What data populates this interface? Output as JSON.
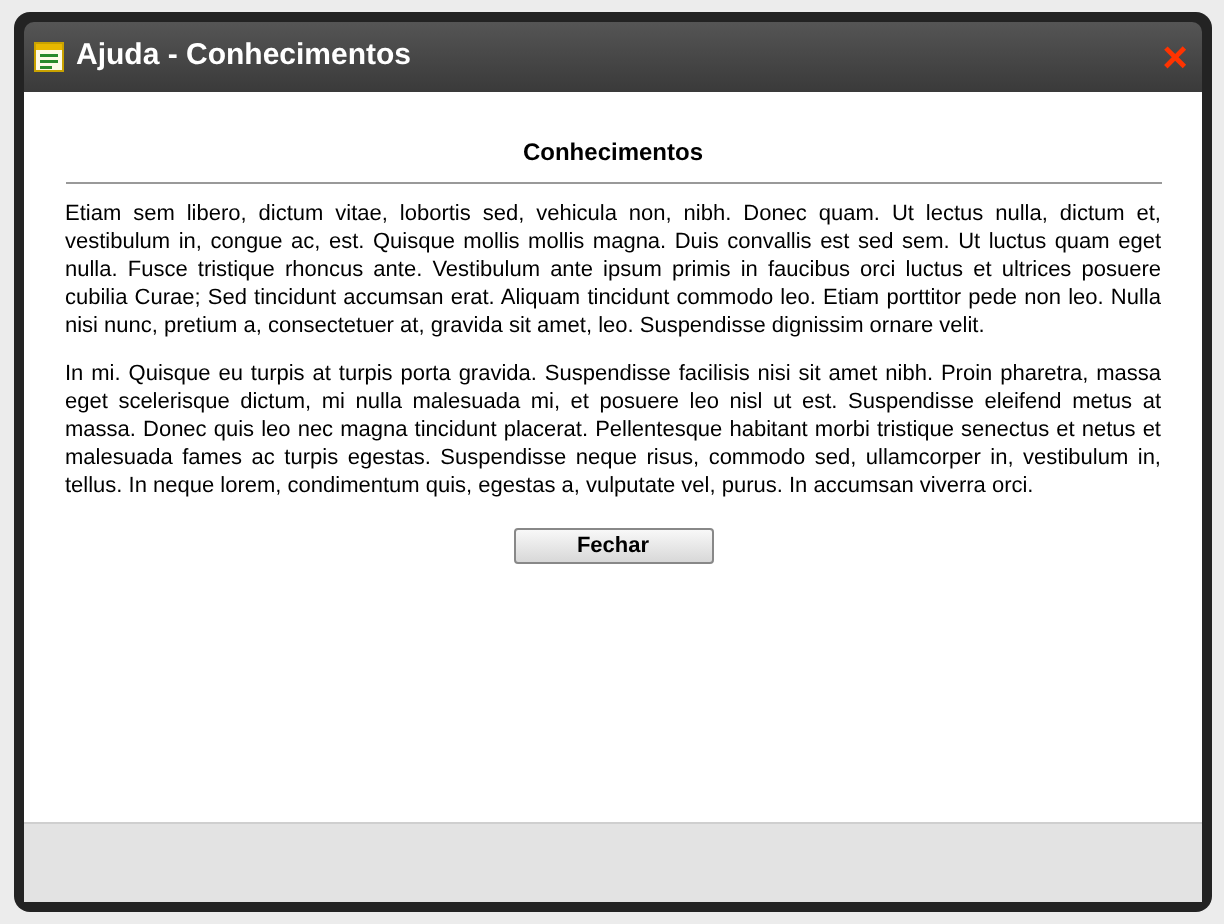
{
  "window": {
    "title": "Ajuda - Conhecimentos",
    "close": "×"
  },
  "heading": "Conhecimentos",
  "paragraphs": [
    "Etiam sem libero, dictum vitae, lobortis sed, vehicula non, nibh. Donec quam. Ut lectus nulla, dictum et, vestibulum in, congue ac, est. Quisque mollis mollis magna. Duis convallis est sed sem. Ut luctus quam eget nulla. Fusce tristique rhoncus ante. Vestibulum ante ipsum primis in faucibus orci luctus et ultrices posuere cubilia Curae; Sed tincidunt accumsan erat. Aliquam tincidunt commodo leo. Etiam porttitor pede non leo. Nulla nisi nunc, pretium a, consectetuer at, gravida sit amet, leo. Suspendisse dignissim ornare velit.",
    "In mi. Quisque eu turpis at turpis porta gravida. Suspendisse facilisis nisi sit amet nibh. Proin pharetra, massa eget scelerisque dictum, mi nulla malesuada mi, et posuere leo nisl ut est. Suspendisse eleifend metus at massa. Donec quis leo nec magna tincidunt placerat. Pellentesque habitant morbi tristique senectus et netus et malesuada fames ac turpis egestas. Suspendisse neque risus, commodo sed, ullamcorper in, vestibulum in, tellus. In neque lorem, condimentum quis, egestas a, vulputate vel, purus. In accumsan viverra orci."
  ],
  "button": "Fechar"
}
